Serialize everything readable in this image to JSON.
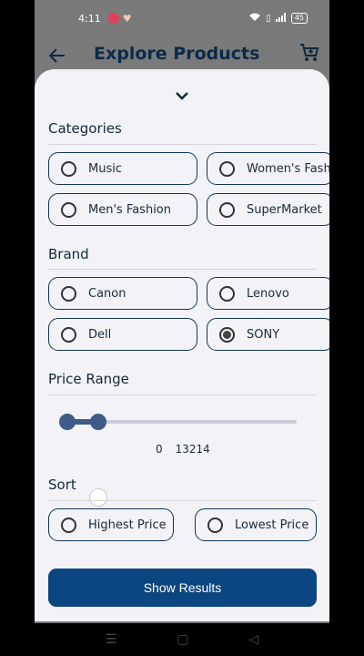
{
  "status_bar": {
    "time": "4:11",
    "battery": "45"
  },
  "app_bar": {
    "title": "Explore Products"
  },
  "filters": {
    "categories": {
      "title": "Categories",
      "options": [
        {
          "label": "Music",
          "selected": false
        },
        {
          "label": "Women's Fashion",
          "selected": false
        },
        {
          "label": "Men's Fashion",
          "selected": false
        },
        {
          "label": "SuperMarket",
          "selected": false
        }
      ]
    },
    "brand": {
      "title": "Brand",
      "options": [
        {
          "label": "Canon",
          "selected": false
        },
        {
          "label": "Lenovo",
          "selected": false
        },
        {
          "label": "Dell",
          "selected": false
        },
        {
          "label": "SONY",
          "selected": true
        }
      ]
    },
    "price_range": {
      "title": "Price Range",
      "min": "0",
      "max": "13214"
    },
    "sort": {
      "title": "Sort",
      "options": [
        {
          "label": "Highest Price",
          "selected": false
        },
        {
          "label": "Lowest Price",
          "selected": false
        }
      ]
    }
  },
  "actions": {
    "show_results": "Show Results"
  },
  "colors": {
    "primary": "#0b4680",
    "slider": "#3d5a89",
    "sheet_bg": "#f3f3f7"
  }
}
